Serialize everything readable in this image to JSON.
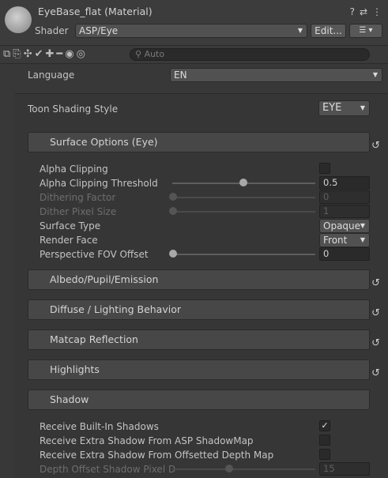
{
  "header": {
    "title": "EyeBase_flat (Material)",
    "shader_label": "Shader",
    "shader_value": "ASP/Eye",
    "edit_label": "Edit...",
    "list_label": "☰ ▾",
    "help_icon": "?",
    "settings_icon": "⇄",
    "menu_icon": "⋮"
  },
  "toolbar": {
    "search_placeholder": "Auto"
  },
  "language": {
    "label": "Language",
    "value": "EN"
  },
  "toon_style": {
    "label": "Toon Shading Style",
    "value": "EYE"
  },
  "surface": {
    "title": "Surface Options (Eye)",
    "alpha_clipping": "Alpha Clipping",
    "alpha_threshold": {
      "label": "Alpha Clipping Threshold",
      "value": "0.5",
      "fraction": 0.5
    },
    "dithering": {
      "label": "Dithering Factor",
      "value": "0",
      "fraction": 0
    },
    "dither_size": {
      "label": "Dither Pixel Size",
      "value": "1",
      "fraction": 0
    },
    "surface_type": {
      "label": "Surface Type",
      "value": "Opaque"
    },
    "render_face": {
      "label": "Render Face",
      "value": "Front"
    },
    "fov_offset": {
      "label": "Perspective FOV Offset",
      "value": "0",
      "fraction": 0
    }
  },
  "sections": {
    "albedo": "Albedo/Pupil/Emission",
    "diffuse": "Diffuse / Lighting Behavior",
    "matcap": "Matcap Reflection",
    "highlights": "Highlights",
    "shadow": "Shadow"
  },
  "shadow": {
    "receive_builtin": "Receive Built-In Shadows",
    "receive_extra": "Receive Extra Shadow From ASP ShadowMap",
    "receive_offset": "Receive Extra Shadow From Offsetted Depth Map",
    "depth_offset": {
      "label": "Depth Offset Shadow Pixel D",
      "value": "15",
      "fraction": 0.5
    }
  },
  "check_mark": "✓",
  "arrow_down": "▼",
  "reset_icon": "↺"
}
